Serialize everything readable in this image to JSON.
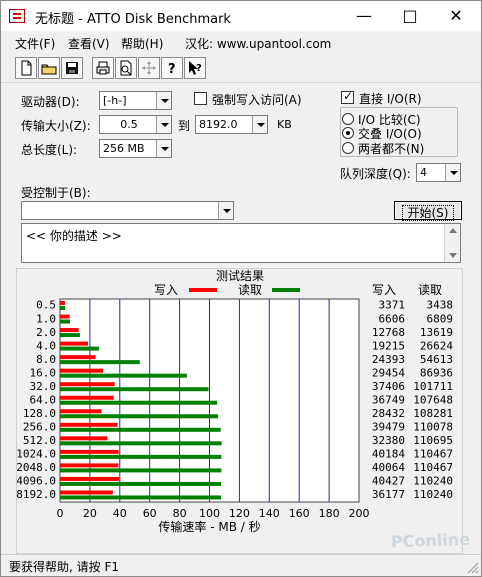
{
  "window": {
    "title": "无标题 - ATTO Disk Benchmark",
    "controls": [
      "—",
      "□",
      "✕"
    ]
  },
  "menu": {
    "items": [
      "文件(F)",
      "查看(V)",
      "帮助(H)",
      "汉化: www.upantool.com"
    ]
  },
  "toolbar": {
    "icons": [
      "new-document-icon",
      "open-folder-icon",
      "save-disk-icon",
      "print-icon",
      "print-preview-icon",
      "move-cross-icon",
      "help-question-icon",
      "context-help-icon"
    ]
  },
  "settings": {
    "drive_label": "驱动器(D):",
    "drive_value": "[-h-]",
    "force_write_label": "强制写入访问(A)",
    "transfer_label": "传输大小(Z):",
    "transfer_from": "0.5",
    "transfer_to_label": "到",
    "transfer_to": "8192.0",
    "transfer_unit": "KB",
    "length_label": "总长度(L):",
    "length_value": "256 MB",
    "direct_io_label": "直接 I/O(R)",
    "io_compare": "I/O 比较(C)",
    "overlap_io": "交叠 I/O(O)",
    "neither": "两者都不(N)",
    "queue_label": "队列深度(Q):",
    "queue_value": "4",
    "controlled_by": "受控制于(B):",
    "controlled_value": "",
    "start_button": "开始(S)",
    "description": "<<   你的描述    >>"
  },
  "chart_data": {
    "type": "bar",
    "title": "测试结果",
    "write_legend": "写入",
    "read_legend": "读取",
    "write_header": "写入",
    "read_header": "读取",
    "xlabel": "传输速率 - MB / 秒",
    "xlim": [
      0,
      200
    ],
    "xticks": [
      0,
      20,
      40,
      60,
      80,
      100,
      120,
      140,
      160,
      180,
      200
    ],
    "grid": true,
    "colors": {
      "write": "#ff0000",
      "read": "#008000",
      "grid": "#1f2fa7"
    },
    "categories": [
      "0.5",
      "1.0",
      "2.0",
      "4.0",
      "8.0",
      "16.0",
      "32.0",
      "64.0",
      "128.0",
      "256.0",
      "512.0",
      "1024.0",
      "2048.0",
      "4096.0",
      "8192.0"
    ],
    "series": [
      {
        "name": "写入",
        "values": [
          3371,
          6606,
          12768,
          19215,
          24393,
          29454,
          37406,
          36749,
          28432,
          39479,
          32380,
          40184,
          40064,
          40427,
          36177
        ]
      },
      {
        "name": "读取",
        "values": [
          3438,
          6809,
          13619,
          26624,
          54613,
          86936,
          101711,
          107648,
          108281,
          110078,
          110695,
          110467,
          110467,
          110240,
          110240
        ]
      }
    ]
  },
  "status": {
    "text": "要获得帮助, 请按 F1"
  },
  "watermark": "PConline"
}
